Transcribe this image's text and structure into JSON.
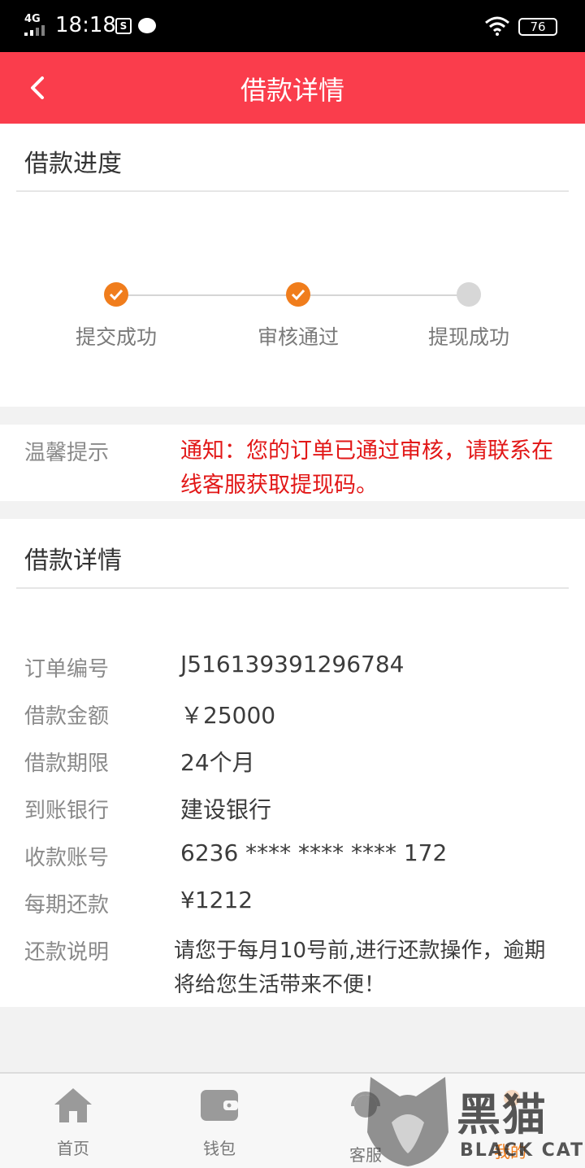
{
  "status_bar": {
    "network": "4G",
    "time": "18:18",
    "battery": "76",
    "app_icon_text": "S"
  },
  "header": {
    "title": "借款详情"
  },
  "progress": {
    "title": "借款进度",
    "steps": [
      {
        "label": "提交成功",
        "done": true
      },
      {
        "label": "审核通过",
        "done": true
      },
      {
        "label": "提现成功",
        "done": false
      }
    ],
    "colors": {
      "done": "#f07d1c",
      "pending": "#d7d7d7"
    }
  },
  "notice": {
    "label": "温馨提示",
    "text": "通知：您的订单已通过审核，请联系在线客服获取提现码。",
    "color": "#e21818"
  },
  "details": {
    "title": "借款详情",
    "rows": [
      {
        "label": "订单编号",
        "value": "J516139391296784"
      },
      {
        "label": "借款金额",
        "value": "￥25000"
      },
      {
        "label": "借款期限",
        "value": "24个月"
      },
      {
        "label": "到账银行",
        "value": "建设银行"
      },
      {
        "label": "收款账号",
        "value": "6236 **** **** **** 172"
      },
      {
        "label": "每期还款",
        "value": "¥1212"
      },
      {
        "label": "还款说明",
        "value": "请您于每月10号前,进行还款操作，逾期将给您生活带来不便！"
      }
    ]
  },
  "tabbar": {
    "items": [
      {
        "label": "首页",
        "icon": "home-icon"
      },
      {
        "label": "钱包",
        "icon": "wallet-icon"
      },
      {
        "label": "客服",
        "icon": "customer-service-icon"
      },
      {
        "label": "我的",
        "icon": "profile-icon",
        "active": true
      }
    ]
  },
  "watermark": {
    "cn": "黑猫",
    "en": "BLACK CAT"
  },
  "colors": {
    "header": "#fa3d4c",
    "accent": "#f07d1c"
  }
}
